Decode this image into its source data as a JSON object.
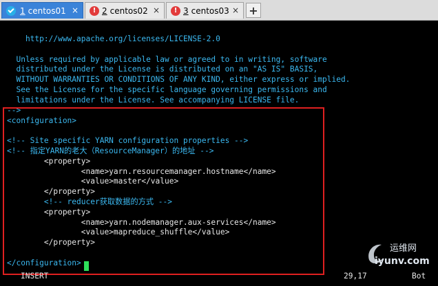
{
  "tabs": [
    {
      "num": "1",
      "label": "centos01",
      "status": "ok",
      "active": true
    },
    {
      "num": "2",
      "label": "centos02",
      "status": "warning",
      "active": false
    },
    {
      "num": "3",
      "label": "centos03",
      "status": "warning",
      "active": false
    }
  ],
  "new_tab_label": "+",
  "close_label": "×",
  "terminal": {
    "lines": [
      "    http://www.apache.org/licenses/LICENSE-2.0",
      "",
      "  Unless required by applicable law or agreed to in writing, software",
      "  distributed under the License is distributed on an \"AS IS\" BASIS,",
      "  WITHOUT WARRANTIES OR CONDITIONS OF ANY KIND, either express or implied.",
      "  See the License for the specific language governing permissions and",
      "  limitations under the License. See accompanying LICENSE file.",
      "-->",
      "<configuration>",
      "",
      "<!-- Site specific YARN configuration properties -->",
      "<!-- 指定YARN的老大（ResourceManager）的地址 -->",
      "        <property>",
      "                <name>yarn.resourcemanager.hostname</name>",
      "                <value>master</value>",
      "        </property>",
      "        <!-- reducer获取数据的方式 -->",
      "        <property>",
      "                <name>yarn.nodemanager.aux-services</name>",
      "                <value>mapreduce_shuffle</value>",
      "        </property>",
      "",
      "</configuration>"
    ],
    "mode": "INSERT",
    "position": "29,17",
    "scroll": "Bot"
  },
  "watermark": {
    "line1": "运维网",
    "line2": "iyunv.com"
  },
  "colors": {
    "highlight": "#e02020",
    "active_tab": "#3a83d9",
    "text_cyan": "#3bb8f0"
  }
}
